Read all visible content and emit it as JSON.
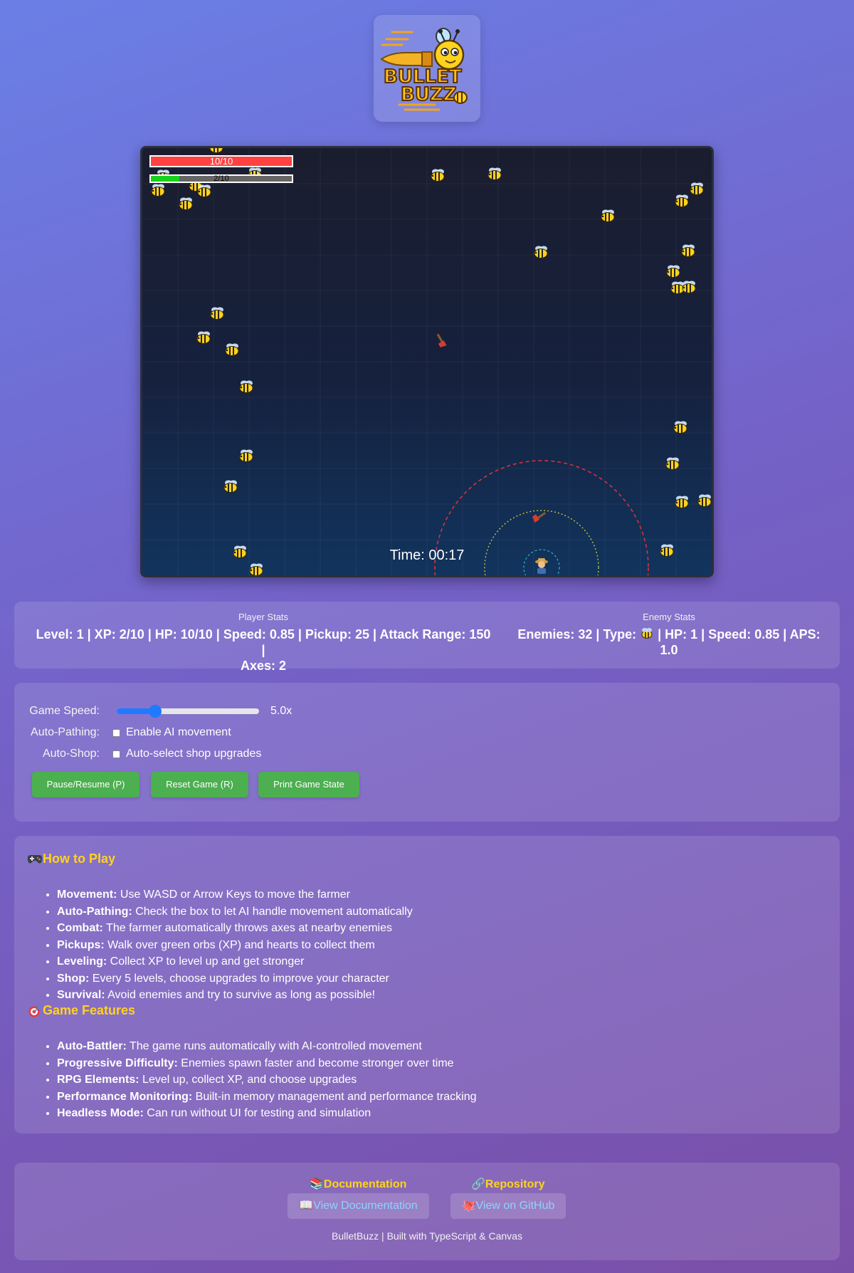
{
  "logo": {
    "line1": "BULLET",
    "line2": "BUZZ"
  },
  "hud": {
    "hp_text": "10/10",
    "hp_fraction": 1.0,
    "xp_text": "2/10",
    "xp_fraction": 0.2,
    "timer": "Time: 00:17",
    "enemy_icon": "bee-icon",
    "player_icon": "farmer-icon",
    "projectile_icon": "axe-icon"
  },
  "stats": {
    "player_title": "Player Stats",
    "player_line1": "Level: 1 | XP: 2/10 | HP: 10/10 | Speed: 0.85 | Pickup: 25 | Attack Range: 150 |",
    "player_line2": "Axes: 2",
    "enemy_title": "Enemy Stats",
    "enemy_line1a": "Enemies: 32 | Type: ",
    "enemy_line1b": " | HP: 1 | Speed: 0.85 | APS:",
    "enemy_line2": "1.0",
    "enemy_type_icon": "bee-icon"
  },
  "controls": {
    "speed_label": "Game Speed:",
    "speed_value": "5.0x",
    "speed_fraction": 0.27,
    "autopath_label": "Auto-Pathing:",
    "autopath_option": "Enable AI movement",
    "autopath_checked": false,
    "autoshop_label": "Auto-Shop:",
    "autoshop_option": "Auto-select shop upgrades",
    "autoshop_checked": false,
    "buttons": {
      "pause": "Pause/Resume (P)",
      "reset": "Reset Game (R)",
      "print": "Print Game State"
    }
  },
  "how_to_play": {
    "icon": "gamepad-icon",
    "title": "How to Play",
    "items": [
      {
        "term": "Movement:",
        "text": " Use WASD or Arrow Keys to move the farmer"
      },
      {
        "term": "Auto-Pathing:",
        "text": " Check the box to let AI handle movement automatically"
      },
      {
        "term": "Combat:",
        "text": " The farmer automatically throws axes at nearby enemies"
      },
      {
        "term": "Pickups:",
        "text": " Walk over green orbs (XP) and hearts to collect them"
      },
      {
        "term": "Leveling:",
        "text": " Collect XP to level up and get stronger"
      },
      {
        "term": "Shop:",
        "text": " Every 5 levels, choose upgrades to improve your character"
      },
      {
        "term": "Survival:",
        "text": " Avoid enemies and try to survive as long as possible!"
      }
    ]
  },
  "features": {
    "icon": "target-icon",
    "title": "Game Features",
    "items": [
      {
        "term": "Auto-Battler:",
        "text": " The game runs automatically with AI-controlled movement"
      },
      {
        "term": "Progressive Difficulty:",
        "text": " Enemies spawn faster and become stronger over time"
      },
      {
        "term": "RPG Elements:",
        "text": " Level up, collect XP, and choose upgrades"
      },
      {
        "term": "Performance Monitoring:",
        "text": " Built-in memory management and performance tracking"
      },
      {
        "term": "Headless Mode:",
        "text": " Can run without UI for testing and simulation"
      }
    ]
  },
  "footer": {
    "docs_heading": "Documentation",
    "docs_icon": "books-icon",
    "repo_heading": "Repository",
    "repo_icon": "link-icon",
    "docs_link": "View Documentation",
    "docs_link_icon": "open-book-icon",
    "repo_link": "View on GitHub",
    "repo_link_icon": "octopus-icon",
    "note": "BulletBuzz | Built with TypeScript & Canvas"
  },
  "colors": {
    "accent_yellow": "#ffd21f",
    "button_green": "#4caf50",
    "hp_red": "#ff4141",
    "xp_green": "#17d11c",
    "slider_blue": "#1e7bff",
    "link_blue": "#8fd1ff"
  }
}
